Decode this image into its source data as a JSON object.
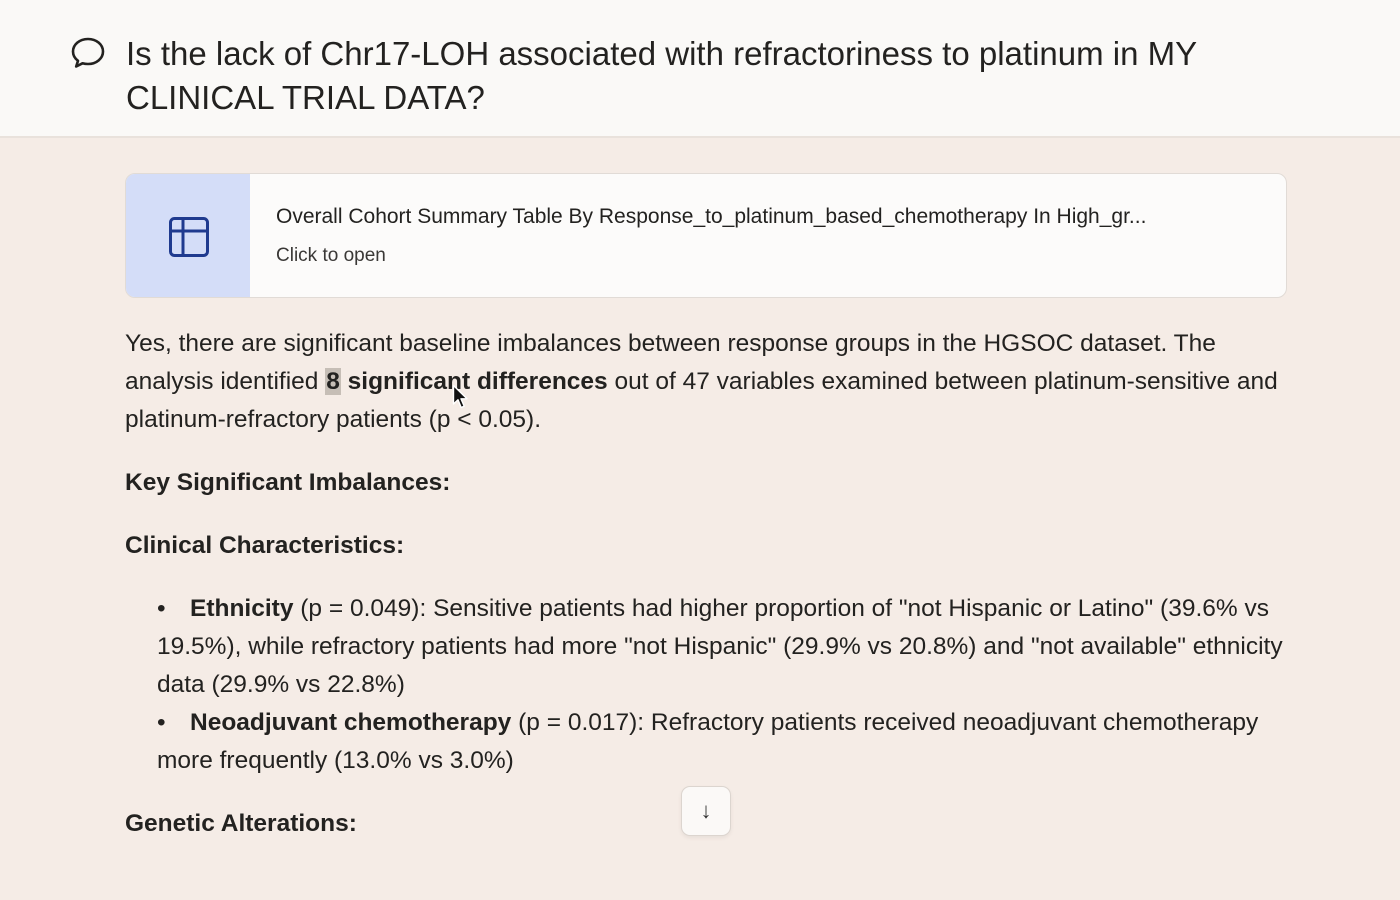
{
  "header": {
    "icon": "chat-bubble-icon",
    "question": "Is the lack of Chr17-LOH associated with refractoriness to platinum in MY CLINICAL TRIAL DATA?"
  },
  "artifact_card": {
    "icon": "table-icon",
    "title": "Overall Cohort Summary Table By Response_to_platinum_based_chemotherapy In High_gr...",
    "subtitle": "Click to open"
  },
  "response": {
    "intro_1": "Yes, there are significant baseline imbalances between response groups in the HGSOC dataset. The analysis identified ",
    "intro_highlight": "8",
    "intro_bold": " significant differences",
    "intro_2": " out of 47 variables examined between platinum-sensitive and platinum-refractory patients (p < 0.05).",
    "heading_key": "Key Significant Imbalances:",
    "heading_clinical": "Clinical Characteristics:",
    "bullets": [
      {
        "term": "Ethnicity",
        "text": " (p = 0.049): Sensitive patients had higher proportion of \"not Hispanic or Latino\" (39.6% vs 19.5%), while refractory patients had more \"not Hispanic\" (29.9% vs 20.8%) and \"not available\" ethnicity data (29.9% vs 22.8%)"
      },
      {
        "term": "Neoadjuvant chemotherapy",
        "text": " (p = 0.017): Refractory patients received neoadjuvant chemotherapy more frequently (13.0% vs 3.0%)"
      }
    ],
    "heading_genetic": "Genetic Alterations:"
  },
  "scroll_button": {
    "icon": "arrow-down-icon",
    "label": "↓"
  },
  "colors": {
    "page_background": "#f5ece6",
    "header_background": "#faf9f7",
    "card_icon_background": "#d4ddf8",
    "table_icon_color": "#1f3a8f"
  }
}
